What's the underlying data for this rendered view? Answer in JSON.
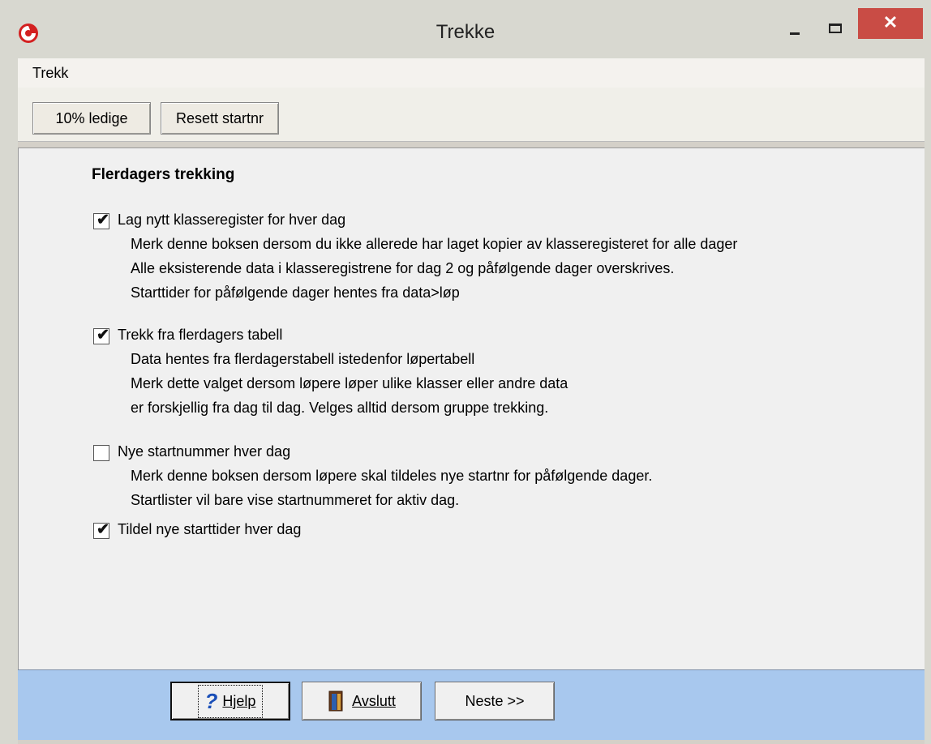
{
  "window": {
    "title": "Trekke",
    "close_glyph": "✕",
    "app_icon": "orienteering-app-icon",
    "accent_close": "#c94c45"
  },
  "menu": {
    "items": [
      {
        "label": "Trekk"
      }
    ]
  },
  "toolbar": {
    "buttons": [
      {
        "label": "10% ledige"
      },
      {
        "label": "Resett startnr"
      }
    ]
  },
  "main": {
    "heading": "Flerdagers trekking",
    "options": [
      {
        "label": "Lag nytt klasseregister for hver dag",
        "checked": true,
        "description": [
          "Merk denne boksen dersom du ikke allerede har laget kopier av klasseregisteret for alle dager",
          "Alle eksisterende data i klasseregistrene for dag 2 og påfølgende dager overskrives.",
          "Starttider for påfølgende dager hentes fra data>løp"
        ]
      },
      {
        "label": "Trekk fra flerdagers tabell",
        "checked": true,
        "description": [
          "Data hentes fra flerdagerstabell istedenfor løpertabell",
          "Merk dette valget dersom løpere løper ulike klasser eller andre data",
          "er forskjellig fra dag til dag. Velges alltid dersom gruppe trekking."
        ]
      },
      {
        "label": "Nye startnummer hver dag",
        "checked": false,
        "description": [
          "Merk denne boksen dersom løpere skal tildeles nye startnr for påfølgende dager.",
          "Startlister vil bare vise startnummeret for aktiv dag."
        ]
      },
      {
        "label": "Tildel nye starttider hver dag",
        "checked": true,
        "description": []
      }
    ]
  },
  "footer": {
    "help": {
      "label": "Hjelp",
      "icon": "question-icon"
    },
    "exit": {
      "label": "Avslutt",
      "icon": "exit-door-icon"
    },
    "next": {
      "label": "Neste >>"
    }
  },
  "colors": {
    "footer_bg": "#a8c8ee",
    "check_mark": "✔"
  }
}
